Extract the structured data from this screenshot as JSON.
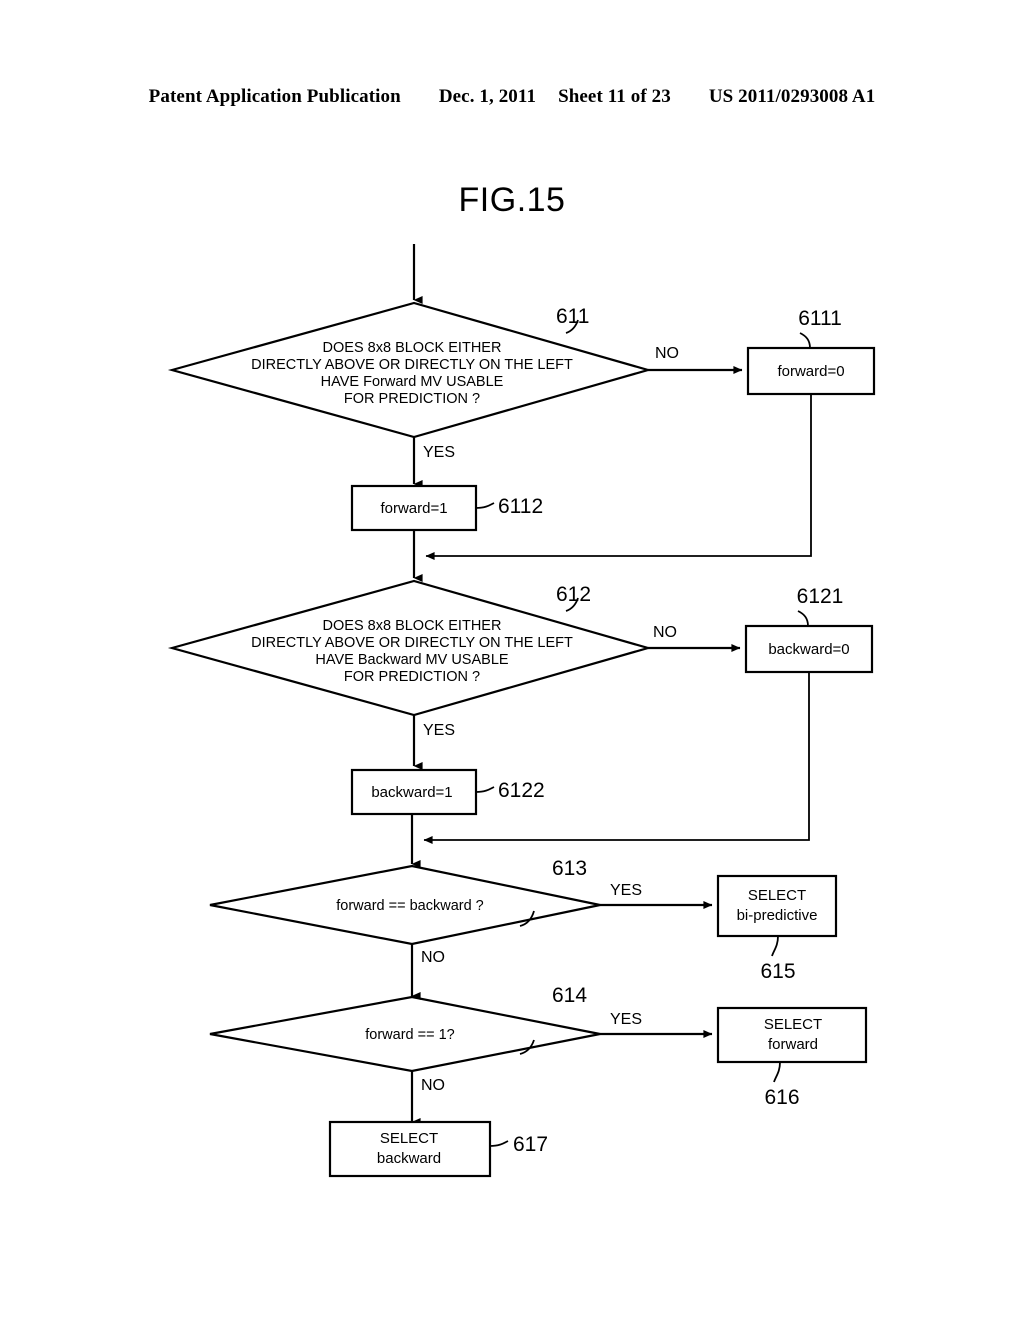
{
  "header": {
    "publication": "Patent Application Publication",
    "date": "Dec. 1, 2011",
    "sheet": "Sheet 11 of 23",
    "number": "US 2011/0293008 A1"
  },
  "figure": {
    "title": "FIG.15"
  },
  "nodes": {
    "d611": {
      "ref": "611",
      "line1": "DOES 8x8 BLOCK EITHER",
      "line2": "DIRECTLY ABOVE OR DIRECTLY ON THE LEFT",
      "line3": "HAVE Forward MV USABLE",
      "line4": "FOR PREDICTION ?"
    },
    "b6111": {
      "ref": "6111",
      "label": "forward=0"
    },
    "b6112": {
      "ref": "6112",
      "label": "forward=1"
    },
    "d612": {
      "ref": "612",
      "line1": "DOES 8x8 BLOCK EITHER",
      "line2": "DIRECTLY ABOVE OR DIRECTLY ON THE LEFT",
      "line3": "HAVE Backward MV USABLE",
      "line4": "FOR PREDICTION ?"
    },
    "b6121": {
      "ref": "6121",
      "label": "backward=0"
    },
    "b6122": {
      "ref": "6122",
      "label": "backward=1"
    },
    "d613": {
      "ref": "613",
      "label": "forward == backward ?"
    },
    "b615": {
      "ref": "615",
      "line1": "SELECT",
      "line2": "bi-predictive"
    },
    "d614": {
      "ref": "614",
      "label": "forward == 1?"
    },
    "b616": {
      "ref": "616",
      "line1": "SELECT",
      "line2": "forward"
    },
    "b617": {
      "ref": "617",
      "line1": "SELECT",
      "line2": "backward"
    }
  },
  "edge_labels": {
    "no_611": "NO",
    "yes_611": "YES",
    "no_612": "NO",
    "yes_612": "YES",
    "yes_613": "YES",
    "no_613": "NO",
    "yes_614": "YES",
    "no_614": "NO"
  },
  "colors": {
    "ink": "#000000",
    "paper": "#ffffff"
  }
}
